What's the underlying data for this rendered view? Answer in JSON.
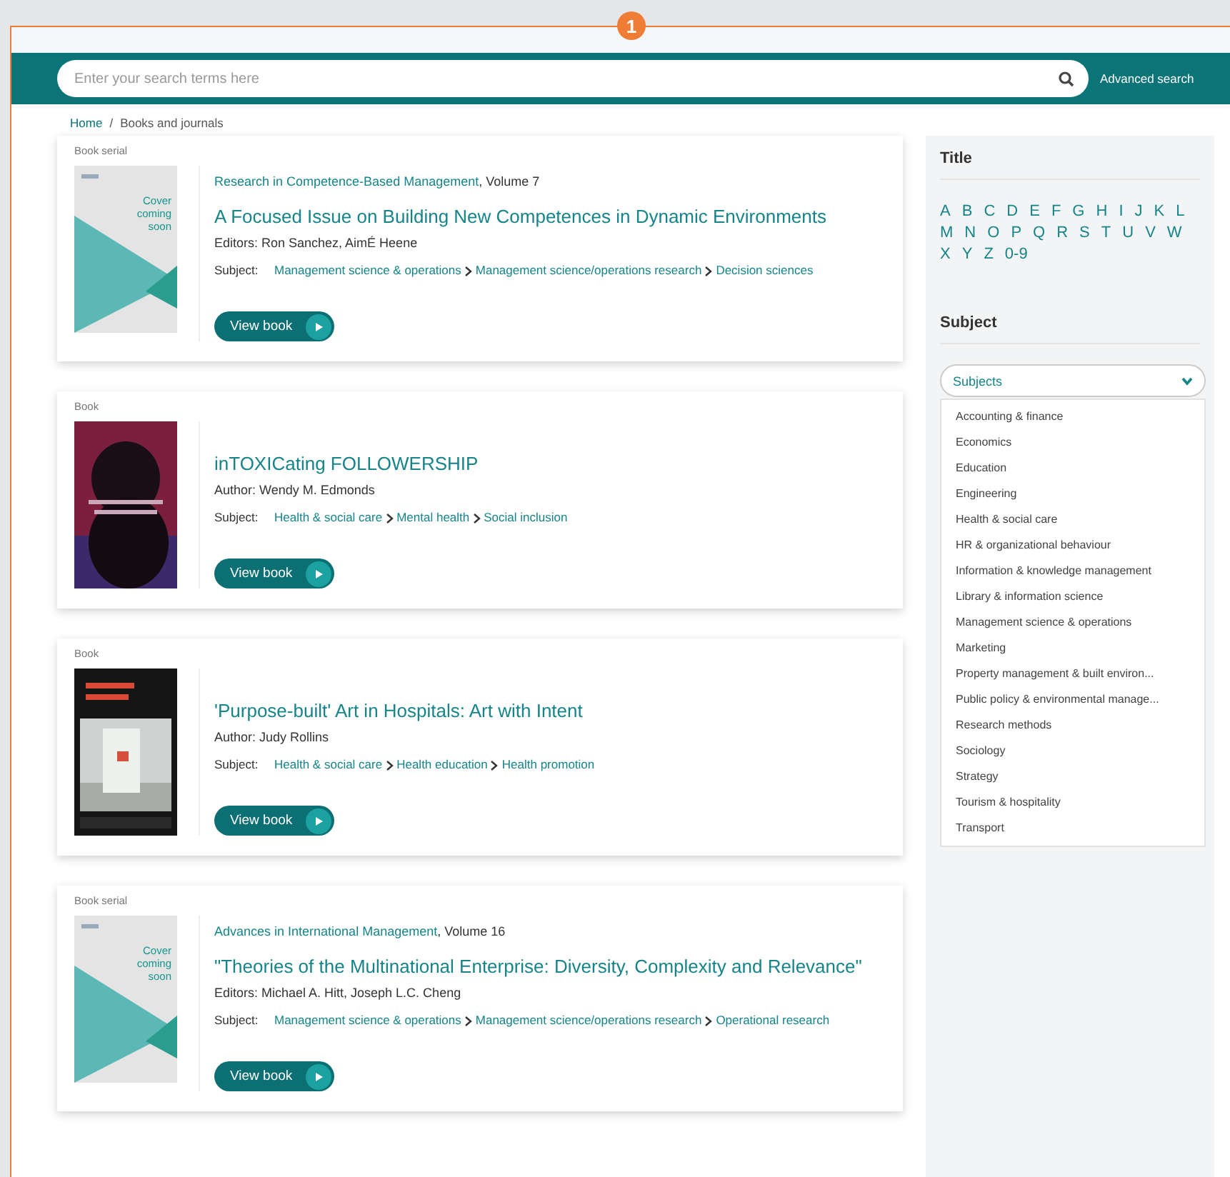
{
  "badge": "1",
  "search": {
    "placeholder": "Enter your search terms here",
    "advanced_link": "Advanced search"
  },
  "breadcrumb": {
    "separator": "/",
    "items": [
      {
        "label": "Home",
        "link": true
      },
      {
        "label": "Books and journals",
        "link": false
      }
    ]
  },
  "results": [
    {
      "type": "Book serial",
      "cover": {
        "kind": "placeholder",
        "text": "Cover coming soon"
      },
      "series": {
        "name": "Research in Competence-Based Management",
        "suffix": ", Volume 7"
      },
      "title": "A Focused Issue on Building New Competences in Dynamic Environments",
      "contributors": "Editors: Ron Sanchez, AimÉ Heene",
      "subject_label": "Subject:",
      "subjects": [
        "Management science & operations",
        "Management science/operations research",
        "Decision sciences"
      ],
      "button": "View book"
    },
    {
      "type": "Book",
      "cover": {
        "kind": "picture"
      },
      "title": "inTOXICating FOLLOWERSHIP",
      "contributors": "Author: Wendy M. Edmonds",
      "subject_label": "Subject:",
      "subjects": [
        "Health & social care",
        "Mental health",
        "Social inclusion"
      ],
      "button": "View book"
    },
    {
      "type": "Book",
      "cover": {
        "kind": "picture"
      },
      "title": "'Purpose-built' Art in Hospitals: Art with Intent",
      "contributors": "Author: Judy Rollins",
      "subject_label": "Subject:",
      "subjects": [
        "Health & social care",
        "Health education",
        "Health promotion"
      ],
      "button": "View book"
    },
    {
      "type": "Book serial",
      "cover": {
        "kind": "placeholder",
        "text": "Cover coming soon"
      },
      "series": {
        "name": "Advances in International Management",
        "suffix": ", Volume 16"
      },
      "title": "\"Theories of the Multinational Enterprise: Diversity, Complexity and Relevance\"",
      "contributors": "Editors: Michael A. Hitt, Joseph L.C. Cheng",
      "subject_label": "Subject:",
      "subjects": [
        "Management science & operations",
        "Management science/operations research",
        "Operational research"
      ],
      "button": "View book"
    }
  ],
  "sidebar": {
    "title_heading": "Title",
    "letters": [
      "A",
      "B",
      "C",
      "D",
      "E",
      "F",
      "G",
      "H",
      "I",
      "J",
      "K",
      "L",
      "M",
      "N",
      "O",
      "P",
      "Q",
      "R",
      "S",
      "T",
      "U",
      "V",
      "W",
      "X",
      "Y",
      "Z",
      "0-9"
    ],
    "subject_heading": "Subject",
    "select": {
      "value": "Subjects",
      "expanded": true,
      "options": [
        "Accounting & finance",
        "Economics",
        "Education",
        "Engineering",
        "Health & social care",
        "HR & organizational behaviour",
        "Information & knowledge management",
        "Library & information science",
        "Management science & operations",
        "Marketing",
        "Property management & built environ...",
        "Public policy & environmental manage...",
        "Research methods",
        "Sociology",
        "Strategy",
        "Tourism & hospitality",
        "Transport"
      ]
    }
  }
}
